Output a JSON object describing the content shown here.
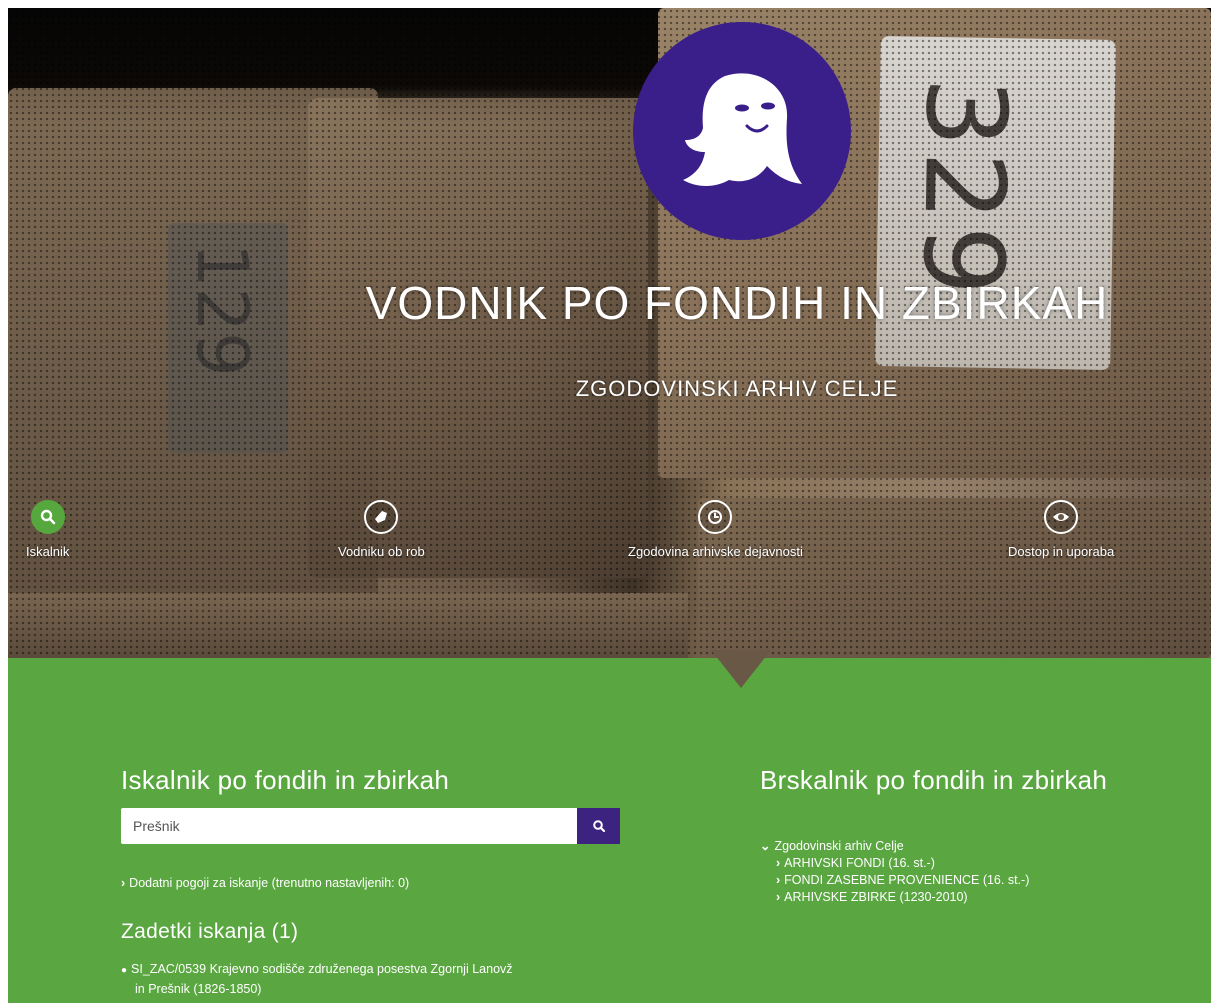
{
  "hero": {
    "title": "VODNIK PO FONDIH IN ZBIRKAH",
    "subtitle": "ZGODOVINSKI ARHIV CELJE",
    "label_number": "329",
    "stamp_number": "129"
  },
  "nav": {
    "items": [
      {
        "label": "Iskalnik",
        "icon": "search-icon"
      },
      {
        "label": "Vodniku ob rob",
        "icon": "note-icon"
      },
      {
        "label": "Zgodovina arhivske dejavnosti",
        "icon": "clock-icon"
      },
      {
        "label": "Dostop in uporaba",
        "icon": "eye-icon"
      }
    ]
  },
  "colors": {
    "green": "#5aa641",
    "purple": "#3a1f8a"
  },
  "search": {
    "heading": "Iskalnik po fondih in zbirkah",
    "value": "Prešnik",
    "extra_conditions": "Dodatni pogoji za iskanje (trenutno nastavljenih: 0)",
    "results_heading": "Zadetki iskanja (1)",
    "results": [
      {
        "line1": "SI_ZAC/0539 Krajevno sodišče združenega posestva Zgornji Lanovž",
        "line2": "in Prešnik (1826-1850)"
      }
    ]
  },
  "browse": {
    "heading": "Brskalnik po fondih in zbirkah",
    "root": "Zgodovinski arhiv Celje",
    "children": [
      "ARHIVSKI FONDI (16. st.-)",
      "FONDI ZASEBNE PROVENIENCE (16. st.-)",
      "ARHIVSKE ZBIRKE (1230-2010)"
    ]
  }
}
